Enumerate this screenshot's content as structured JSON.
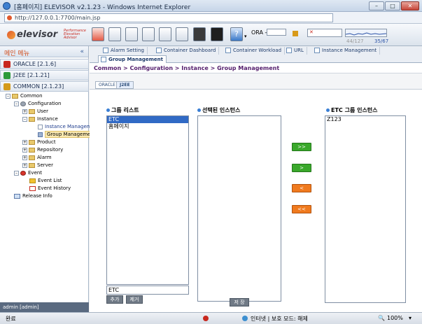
{
  "window": {
    "title": "[홈페이지] ELEVISOR v2.1.23 - Windows Internet Explorer"
  },
  "browser": {
    "url": "http://127.0.0.1:7700/main.jsp"
  },
  "app": {
    "brand": "elevisor",
    "tagline": [
      "Performance",
      "Elevation",
      "Advisor"
    ],
    "db_label": "ORA -",
    "counter_left": "44/127",
    "counter_right": "35/67"
  },
  "sidebar": {
    "header": "메인 메뉴",
    "collapse_glyph": "«",
    "groups": [
      {
        "label": "ORACLE [2.1.6]",
        "color": "#c8281e"
      },
      {
        "label": "J2EE [2.1.21]",
        "color": "#2d9a3a"
      },
      {
        "label": "COMMON [2.1.23]",
        "color": "#d49a1a"
      }
    ],
    "tree": {
      "common": "Common",
      "configuration": "Configuration",
      "user": "User",
      "instance": "Instance",
      "instance_mgmt": "Instance Managemen",
      "group_mgmt": "Group Management",
      "product": "Product",
      "repository": "Repository",
      "alarm": "Alarm",
      "server": "Server",
      "event": "Event",
      "event_list": "Event List",
      "event_history": "Event History",
      "release_info": "Release Info"
    },
    "footer": "admin [admin]"
  },
  "tabs": [
    {
      "label": "Alarm Setting"
    },
    {
      "label": "Container Dashboard"
    },
    {
      "label": "Container Workload"
    },
    {
      "label": "URL"
    },
    {
      "label": "Instance Management"
    },
    {
      "label": "Group Management"
    }
  ],
  "breadcrumb": "Common > Configuration > Instance > Group Management",
  "subtabs": [
    {
      "label": "ORACLE"
    },
    {
      "label": "J2EE"
    }
  ],
  "group_list": {
    "title": "그룹 리스트",
    "items": [
      "ETC",
      "홈페이지"
    ],
    "selected": "ETC",
    "input_value": "ETC",
    "add_label": "추가",
    "remove_label": "제거"
  },
  "selected_instances": {
    "title": "선택된 인스턴스",
    "items": []
  },
  "group_instances": {
    "title": "ETC 그룹 인스턴스",
    "items": [
      "Z123"
    ]
  },
  "move_buttons": [
    {
      "label": ">>",
      "color": "#3aa82b"
    },
    {
      "label": ">",
      "color": "#3aa82b"
    },
    {
      "label": "<",
      "color": "#f07a1e"
    },
    {
      "label": "<<",
      "color": "#f07a1e"
    }
  ],
  "save_label": "저 장",
  "status": {
    "left": "완료",
    "zone": "인터넷 | 보호 모드: 해제",
    "zoom": "100%"
  }
}
